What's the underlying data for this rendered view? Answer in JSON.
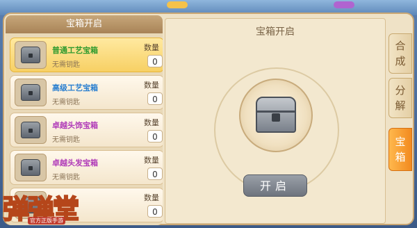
{
  "tabs_left_panel": {
    "header": "宝箱开启"
  },
  "items": [
    {
      "name": "普通工艺宝箱",
      "name_color": "#2e9a2e",
      "sub": "无需钥匙",
      "qty_label": "数量",
      "qty": "0",
      "selected": true
    },
    {
      "name": "高级工艺宝箱",
      "name_color": "#2a7fd0",
      "sub": "无需钥匙",
      "qty_label": "数量",
      "qty": "0",
      "selected": false
    },
    {
      "name": "卓越头饰宝箱",
      "name_color": "#b03ab8",
      "sub": "无需钥匙",
      "qty_label": "数量",
      "qty": "0",
      "selected": false
    },
    {
      "name": "卓越头发宝箱",
      "name_color": "#b03ab8",
      "sub": "无需钥匙",
      "qty_label": "数量",
      "qty": "0",
      "selected": false
    },
    {
      "name": "",
      "name_color": "#b03ab8",
      "sub": "",
      "qty_label": "数量",
      "qty": "0",
      "selected": false
    }
  ],
  "right_panel": {
    "title": "宝箱开启",
    "open_button": "开启"
  },
  "side_tabs": [
    {
      "c1": "合",
      "c2": "成",
      "active": false
    },
    {
      "c1": "分",
      "c2": "解",
      "active": false
    },
    {
      "c1": "宝",
      "c2": "箱",
      "active": true
    }
  ],
  "logo": {
    "text": "弹弹堂",
    "sub": "官方正版手游"
  }
}
